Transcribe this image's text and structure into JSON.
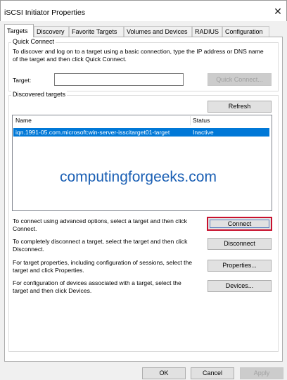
{
  "window": {
    "title": "iSCSI Initiator Properties",
    "close_glyph": "✕"
  },
  "tabs": [
    {
      "label": "Targets",
      "active": true
    },
    {
      "label": "Discovery",
      "active": false
    },
    {
      "label": "Favorite Targets",
      "active": false
    },
    {
      "label": "Volumes and Devices",
      "active": false
    },
    {
      "label": "RADIUS",
      "active": false
    },
    {
      "label": "Configuration",
      "active": false
    }
  ],
  "quick_connect": {
    "legend": "Quick Connect",
    "description": "To discover and log on to a target using a basic connection, type the IP address or DNS name of the target and then click Quick Connect.",
    "target_label": "Target:",
    "target_value": "",
    "button_label": "Quick Connect..."
  },
  "discovered": {
    "legend": "Discovered targets",
    "refresh_label": "Refresh",
    "columns": [
      "Name",
      "Status"
    ],
    "rows": [
      {
        "name": "iqn.1991-05.com.microsoft:win-server-isscitarget01-target",
        "status": "Inactive",
        "selected": true
      }
    ],
    "watermark": "computingforgeeks.com"
  },
  "actions": [
    {
      "text": "To connect using advanced options, select a target and then click Connect.",
      "button": "Connect",
      "focused": true
    },
    {
      "text": "To completely disconnect a target, select the target and then click Disconnect.",
      "button": "Disconnect",
      "focused": false
    },
    {
      "text": "For target properties, including configuration of sessions, select the target and click Properties.",
      "button": "Properties...",
      "focused": false
    },
    {
      "text": "For configuration of devices associated with a target, select the target and then click Devices.",
      "button": "Devices...",
      "focused": false
    }
  ],
  "footer": {
    "ok_label": "OK",
    "cancel_label": "Cancel",
    "apply_label": "Apply"
  },
  "colors": {
    "selection": "#0078d7",
    "focus_border": "#c8102e",
    "watermark": "#1a5fb4"
  }
}
